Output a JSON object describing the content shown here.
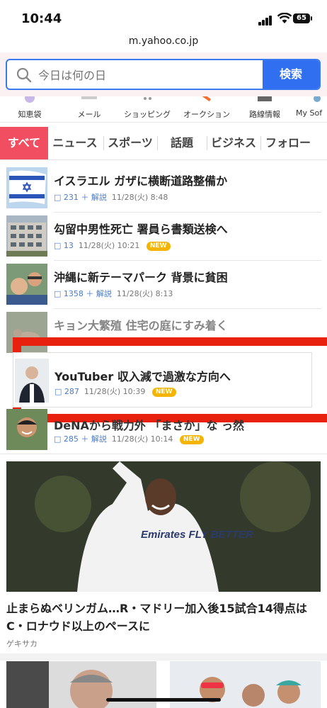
{
  "status": {
    "time": "10:44",
    "battery": "65"
  },
  "url": "m.yahoo.co.jp",
  "search": {
    "placeholder": "今日は何の日",
    "button": "検索"
  },
  "services": [
    "知恵袋",
    "メール",
    "ショッピング",
    "オークション",
    "路線情報",
    "My Sof"
  ],
  "tabs": [
    "すべて",
    "ニュース",
    "スポーツ",
    "話題",
    "ビジネス",
    "フォロー"
  ],
  "news": [
    {
      "title": "イスラエル ガザに横断道路整備か",
      "comments": "231",
      "extra": "＋ 解説",
      "date": "11/28(火) 8:48",
      "badge": ""
    },
    {
      "title": "勾留中男性死亡 署員ら書類送検へ",
      "comments": "13",
      "extra": "",
      "date": "11/28(火) 10:21",
      "badge": "NEW"
    },
    {
      "title": "沖縄に新テーマパーク 背景に貧困",
      "comments": "1358",
      "extra": "＋ 解説",
      "date": "11/28(火) 8:13",
      "badge": ""
    },
    {
      "title": "キョン大繁殖 住宅の庭にすみ着く",
      "comments": "",
      "extra": "",
      "date": "",
      "badge": ""
    },
    {
      "title": "YouTuber 収入減で過激な方向へ",
      "comments": "287",
      "extra": "",
      "date": "11/28(火) 10:39",
      "badge": "NEW"
    },
    {
      "title": "DeNAから戦力外 「まさか」な っ然",
      "comments": "285",
      "extra": "＋ 解説",
      "date": "11/28(火) 10:14",
      "badge": "NEW"
    }
  ],
  "featured": {
    "title": "止まらぬベリンガム…R・マドリー加入後15試合14得点はC・ロナウド以上のペースに",
    "source": "ゲキサカ",
    "jersey_text": "Emirates FLY BETTER"
  }
}
